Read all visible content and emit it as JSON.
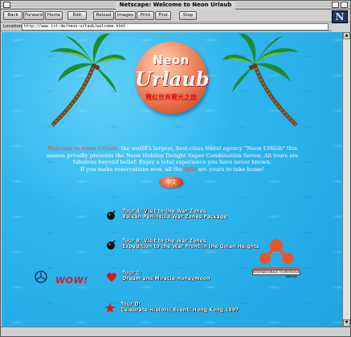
{
  "window": {
    "title": "Netscape: Welcome to Neon Urlaub"
  },
  "toolbar": {
    "buttons": [
      "Back",
      "Forward",
      "Home",
      "Edit",
      "Reload",
      "Images",
      "Print",
      "Find",
      "Stop"
    ]
  },
  "location": {
    "label": "Location:",
    "url": "http://www.ist.de/neon-urlaub/welcome.html"
  },
  "logo": {
    "line1": "Neon",
    "line2": "Urlaub",
    "line3": "霓虹世界霓光之旅"
  },
  "intro": {
    "brand": "Welcome to Neon Urlaub,",
    "line1_rest": " the world's largest, best-class travel agency \"Neon Urlaub\" this",
    "line2": "season proudly presents the Neon Holiday Delight Super Combination Series. All tours are",
    "line3": "fabulous beyond belief. Enjoy a total experience you have never known.",
    "line4_start": "If you make reservations now, all the ",
    "line4_highlight": "gifts",
    "line4_end": " are yours to take home!"
  },
  "language_button": {
    "label": "中文"
  },
  "tours": [
    {
      "icon": "bomb-icon",
      "line1": "Tour A: Visit to the War Zones",
      "line2": "Balkan Peninsula War Zones Package"
    },
    {
      "icon": "bomb-icon",
      "line1": "Tour B: Visit to the War Zones",
      "line2": "Expedition to the War Front in the Golan Heights"
    },
    {
      "icon": "heart-icon",
      "line1": "Tour C:",
      "line2": "Dream and Miracle Honeymoon"
    },
    {
      "icon": "star-icon",
      "line1": "Tour D:",
      "line2": "Celebrate Historic Event: Hong Kong 1997"
    }
  ],
  "promo": {
    "wow": "WOW!"
  },
  "itb": {
    "caption": "INTERNATIONALE TOURISMUS-BÖRSE",
    "city": "BERLIN"
  },
  "colors": {
    "background": "#2fb6ee",
    "logo": "#e0623c",
    "highlight": "#e8453a"
  }
}
